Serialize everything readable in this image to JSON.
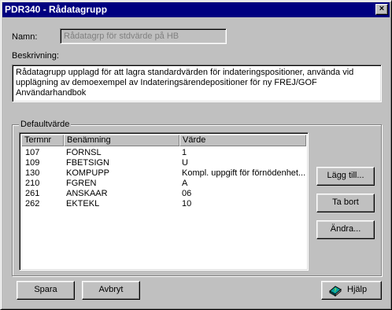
{
  "window": {
    "title": "PDR340 - Rådatagrupp",
    "close_label": "×"
  },
  "form": {
    "namn_label": "Namn:",
    "namn_value": "Rådatagrp för stdvärde på HB",
    "beskrivning_label": "Beskrivning:",
    "beskrivning_value": "Rådatagrupp upplagd för att lagra standardvärden för indateringspositioner, använda vid upplägning av demoexempel av Indateringsärendepositioner för ny FREJ/GOF Användarhandbok"
  },
  "defaults": {
    "group_label": "Defaultvärde",
    "columns": [
      "Termnr",
      "Benämning",
      "Värde"
    ],
    "rows": [
      [
        "107",
        "FÖRNSL",
        "1"
      ],
      [
        "109",
        "FBETSIGN",
        "U"
      ],
      [
        "130",
        "KOMPUPP",
        "Kompl. uppgift för förnödenhet..."
      ],
      [
        "210",
        "FGREN",
        "A"
      ],
      [
        "261",
        "ANSKAAR",
        "06"
      ],
      [
        "262",
        "EKTEKL",
        "10"
      ]
    ],
    "buttons": {
      "add": "Lägg till...",
      "remove": "Ta bort",
      "change": "Ändra..."
    }
  },
  "footer": {
    "save": "Spara",
    "cancel": "Avbryt",
    "help": "Hjälp"
  },
  "icons": {
    "help": "help-book-icon",
    "close": "close-icon"
  }
}
